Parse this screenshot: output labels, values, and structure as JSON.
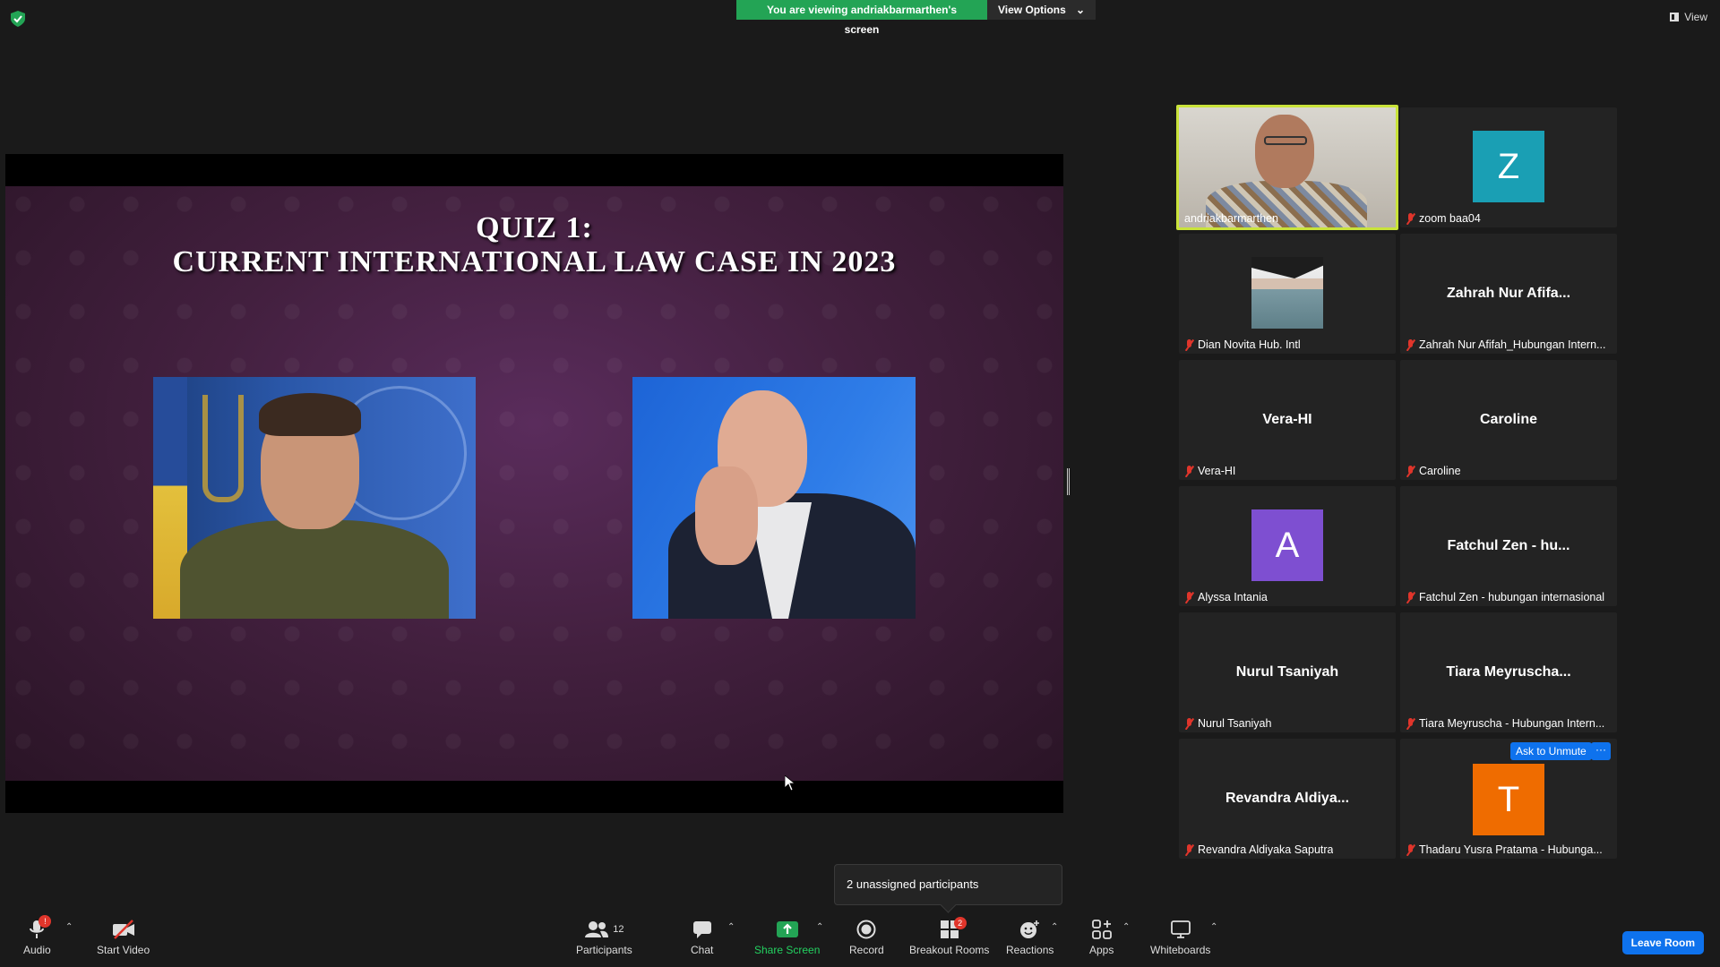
{
  "top": {
    "share_banner": "You are viewing andriakbarmarthen's screen",
    "view_options": "View Options",
    "view": "View"
  },
  "slide": {
    "title_line1": "QUIZ 1:",
    "title_line2": "CURRENT INTERNATIONAL LAW CASE IN 2023"
  },
  "gallery": {
    "tiles": [
      {
        "label": "andriakbarmarthen",
        "display": "",
        "avatar_letter": "",
        "avatar_color": ""
      },
      {
        "label": "zoom baa04",
        "display": "",
        "avatar_letter": "Z",
        "avatar_color": "#1a9fb4"
      },
      {
        "label": "Dian Novita Hub. Intl",
        "display": "",
        "avatar_letter": "",
        "avatar_color": ""
      },
      {
        "label": "Zahrah Nur Afifah_Hubungan Intern...",
        "display": "Zahrah Nur Afifa...",
        "avatar_letter": "",
        "avatar_color": ""
      },
      {
        "label": "Vera-HI",
        "display": "Vera-HI",
        "avatar_letter": "",
        "avatar_color": ""
      },
      {
        "label": "Caroline",
        "display": "Caroline",
        "avatar_letter": "",
        "avatar_color": ""
      },
      {
        "label": "Alyssa Intania",
        "display": "",
        "avatar_letter": "A",
        "avatar_color": "#7e4fd1"
      },
      {
        "label": "Fatchul Zen - hubungan internasional",
        "display": "Fatchul Zen - hu...",
        "avatar_letter": "",
        "avatar_color": ""
      },
      {
        "label": "Nurul Tsaniyah",
        "display": "Nurul Tsaniyah",
        "avatar_letter": "",
        "avatar_color": ""
      },
      {
        "label": "Tiara Meyruscha - Hubungan Intern...",
        "display": "Tiara Meyruscha...",
        "avatar_letter": "",
        "avatar_color": ""
      },
      {
        "label": "Revandra Aldiyaka Saputra",
        "display": "Revandra Aldiya...",
        "avatar_letter": "",
        "avatar_color": ""
      },
      {
        "label": "Thadaru Yusra Pratama - Hubunga...",
        "display": "",
        "avatar_letter": "T",
        "avatar_color": "#ef6c00"
      }
    ],
    "ask_to_unmute": "Ask to Unmute",
    "more": "···"
  },
  "popup": {
    "text": "2 unassigned participants"
  },
  "toolbar": {
    "audio": "Audio",
    "audio_badge": "!",
    "start_video": "Start Video",
    "participants": "Participants",
    "participants_count": "12",
    "chat": "Chat",
    "share_screen": "Share Screen",
    "record": "Record",
    "breakout_rooms": "Breakout Rooms",
    "breakout_badge": "2",
    "reactions": "Reactions",
    "apps": "Apps",
    "whiteboards": "Whiteboards",
    "leave_room": "Leave Room"
  }
}
